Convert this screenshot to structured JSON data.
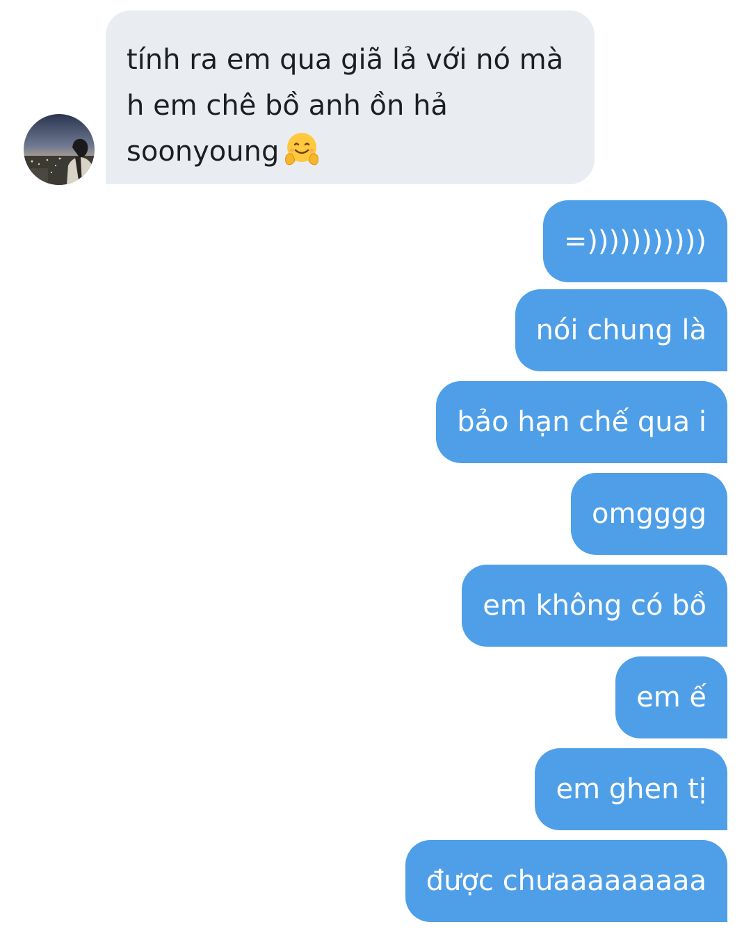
{
  "received": {
    "lines": [
      "tính ra em qua giã lả với nó mà",
      "h em chê bồ anh ồn hả",
      "soonyoung"
    ],
    "emoji_icon": "hugging-face-emoji"
  },
  "sent": [
    "=)))))))))))",
    "nói chung là",
    "bảo hạn chế qua i",
    "omgggg",
    "em không có bồ",
    "em ế",
    "em ghen tị",
    "được chưaaaaaaaaa"
  ],
  "colors": {
    "received_bubble": "#e9edf1",
    "sent_bubble": "#4f9fe8",
    "received_text": "#1c1f22",
    "sent_text": "#ffffff"
  }
}
